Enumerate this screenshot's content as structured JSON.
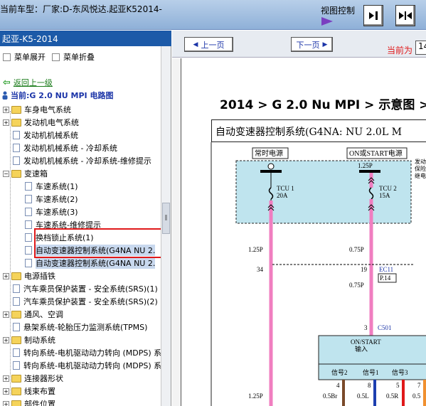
{
  "window": {
    "title": "当前车型：厂家:D-东风悦达.起亚K52014-",
    "view_control_label": "视图控制"
  },
  "sidebar": {
    "header": "起亚-K5-2014",
    "expand_label": "菜单展开",
    "collapse_label": "菜单折叠",
    "back_label": "返回上一级",
    "current_label": "当前:G 2.0 NU MPI 电路图",
    "items": [
      {
        "label": "车身电气系统",
        "type": "folder"
      },
      {
        "label": "发动机电气系统",
        "type": "folder"
      },
      {
        "label": "发动机机械系统",
        "type": "doc"
      },
      {
        "label": "发动机机械系统 - 冷却系统",
        "type": "doc"
      },
      {
        "label": "发动机机械系统 - 冷却系统-维修提示",
        "type": "doc"
      },
      {
        "label": "变速箱",
        "type": "folder"
      },
      {
        "label": "车速系统(1)",
        "type": "doc"
      },
      {
        "label": "车速系统(2)",
        "type": "doc"
      },
      {
        "label": "车速系统(3)",
        "type": "doc"
      },
      {
        "label": "车速系统-维修提示",
        "type": "doc"
      },
      {
        "label": "换档锁止系统(1)",
        "type": "doc"
      },
      {
        "label": "自动变速器控制系统(G4NA NU 2.",
        "type": "doc"
      },
      {
        "label": "自动变速器控制系统(G4NA NU 2.",
        "type": "doc"
      },
      {
        "label": "电源插铁",
        "type": "folder"
      },
      {
        "label": "汽车乘员保护装置 - 安全系统(SRS)(1)",
        "type": "doc"
      },
      {
        "label": "汽车乘员保护装置 - 安全系统(SRS)(2)",
        "type": "doc"
      },
      {
        "label": "通风、空调",
        "type": "folder"
      },
      {
        "label": "悬架系统-轮胎压力监测系统(TPMS)",
        "type": "doc"
      },
      {
        "label": "制动系统",
        "type": "folder"
      },
      {
        "label": "转向系统-电机驱动动力转向 (MDPS) 系",
        "type": "doc"
      },
      {
        "label": "转向系统-电机驱动动力转向 (MDPS) 系",
        "type": "doc"
      },
      {
        "label": "连接器形状",
        "type": "folder"
      },
      {
        "label": "线束布置",
        "type": "folder"
      },
      {
        "label": "部件位置",
        "type": "folder"
      }
    ]
  },
  "toolbar": {
    "prev_label": "上一页",
    "next_label": "下一页",
    "current_label": "当前为",
    "page_value": "14"
  },
  "document": {
    "breadcrumb": "2014 > G 2.0 Nu MPI > 示意图 >",
    "diagram_title": "自动变速器控制系统(G4NA: NU 2.0L M",
    "diagram": {
      "hot_label": "常时电源",
      "on_label": "ON或START电源",
      "fuse1_name": "TCU 1",
      "fuse1_amp": "20A",
      "fuse2_name": "TCU 2",
      "fuse2_amp": "15A",
      "wire_top_right": "1.25P",
      "side_note_1": "发动",
      "side_note_2": "保险",
      "side_note_3": "继电",
      "wire_1": "1.25P",
      "wire_2": "0.75P",
      "pin_34": "34",
      "pin_19": "19",
      "connector_ec11": "EC11",
      "page_ref": "P.14",
      "wire_3": "0.75P",
      "pin_3": "3",
      "connector_c501": "C501",
      "module_label_1": "ON/START",
      "module_label_2": "输入",
      "signal_2": "信号2",
      "signal_1": "信号1",
      "signal_3": "信号3",
      "pin_4": "4",
      "pin_8": "8",
      "pin_5": "5",
      "pin_7": "7",
      "wire_4": "1.25P",
      "wire_br": "0.5Br",
      "wire_l": "0.5L",
      "wire_r": "0.5R",
      "wire_o": "0.5"
    }
  },
  "colors": {
    "header_blue": "#1c5aa8",
    "highlight_red": "#e0191a",
    "wire_pink": "#f07ec0",
    "panel_cyan": "#bfe4ee"
  }
}
